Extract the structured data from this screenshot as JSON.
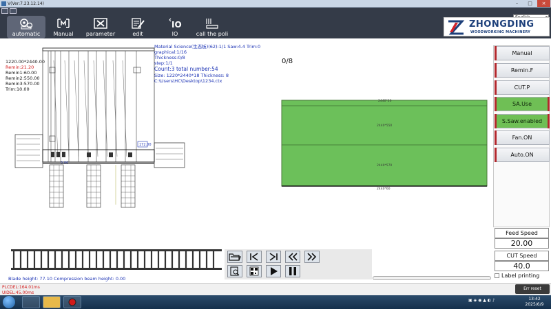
{
  "window": {
    "title": "V(Ver:7.23.12.14)"
  },
  "toolbar": {
    "items": [
      {
        "label": "automatic"
      },
      {
        "label": "Manual"
      },
      {
        "label": "parameter"
      },
      {
        "label": "edit"
      },
      {
        "label": "IO"
      },
      {
        "label": "call the poli"
      }
    ],
    "language": "English"
  },
  "brand": {
    "name": "ZHONGDING",
    "tagline": "WOODWORKING MACHINERY"
  },
  "dimensions": {
    "size": "1220.00*2440.00",
    "remin": "Remin:21.20",
    "remin1": "Remin1:60.00",
    "remin2": "Remin2:550.00",
    "remin3": "Remin3:570.00",
    "trim": "Trim:10.00"
  },
  "info": {
    "material": "Material Science(生态板)(62):1/1 Saw:4.4 Trim:0",
    "graphical": "graphical:1/16",
    "thickness": "Thickness:0/8",
    "step": "step:1/1",
    "count": "Count:3 total number:54",
    "size_line": "Size: 1220*2440*18  Thickness: 8",
    "path": "C:\\Users\\HC\\Desktop\\1234.ctx"
  },
  "machine": {
    "label_right": "172.00",
    "label_left": "0.00"
  },
  "counter": "0/8",
  "board": {
    "top_label": "2440*20",
    "mid_label": "2440*550",
    "bot_label": "2440*570",
    "bottom_label": "2440*60"
  },
  "right_buttons": [
    {
      "label": "Manual",
      "state": "off"
    },
    {
      "label": "Remin.F",
      "state": "off"
    },
    {
      "label": "CUT.P",
      "state": "off"
    },
    {
      "label": "SA.Use",
      "state": "on"
    },
    {
      "label": "S.Saw.enabled",
      "state": "on"
    },
    {
      "label": "Fan.ON",
      "state": "off"
    },
    {
      "label": "Auto.ON",
      "state": "off"
    }
  ],
  "feed": {
    "label": "Feed Speed",
    "value": "20.00"
  },
  "cut": {
    "label": "CUT Speed",
    "value": "40.0"
  },
  "label_printing": "Label printing",
  "status": {
    "blade": "Blade height: 77.10   Compression beam height: 0.00",
    "plc": "PLCDEL:164.01ms",
    "ui": "UIDEL:45.00ms"
  },
  "err_reset": "Err reset",
  "clock": {
    "time": "13:42",
    "date": "2025/6/9"
  },
  "colors": {
    "toolbar": "#343b48",
    "board": "#6cc05a",
    "accent_red": "#b3282d",
    "info_blue": "#1a31b4"
  }
}
